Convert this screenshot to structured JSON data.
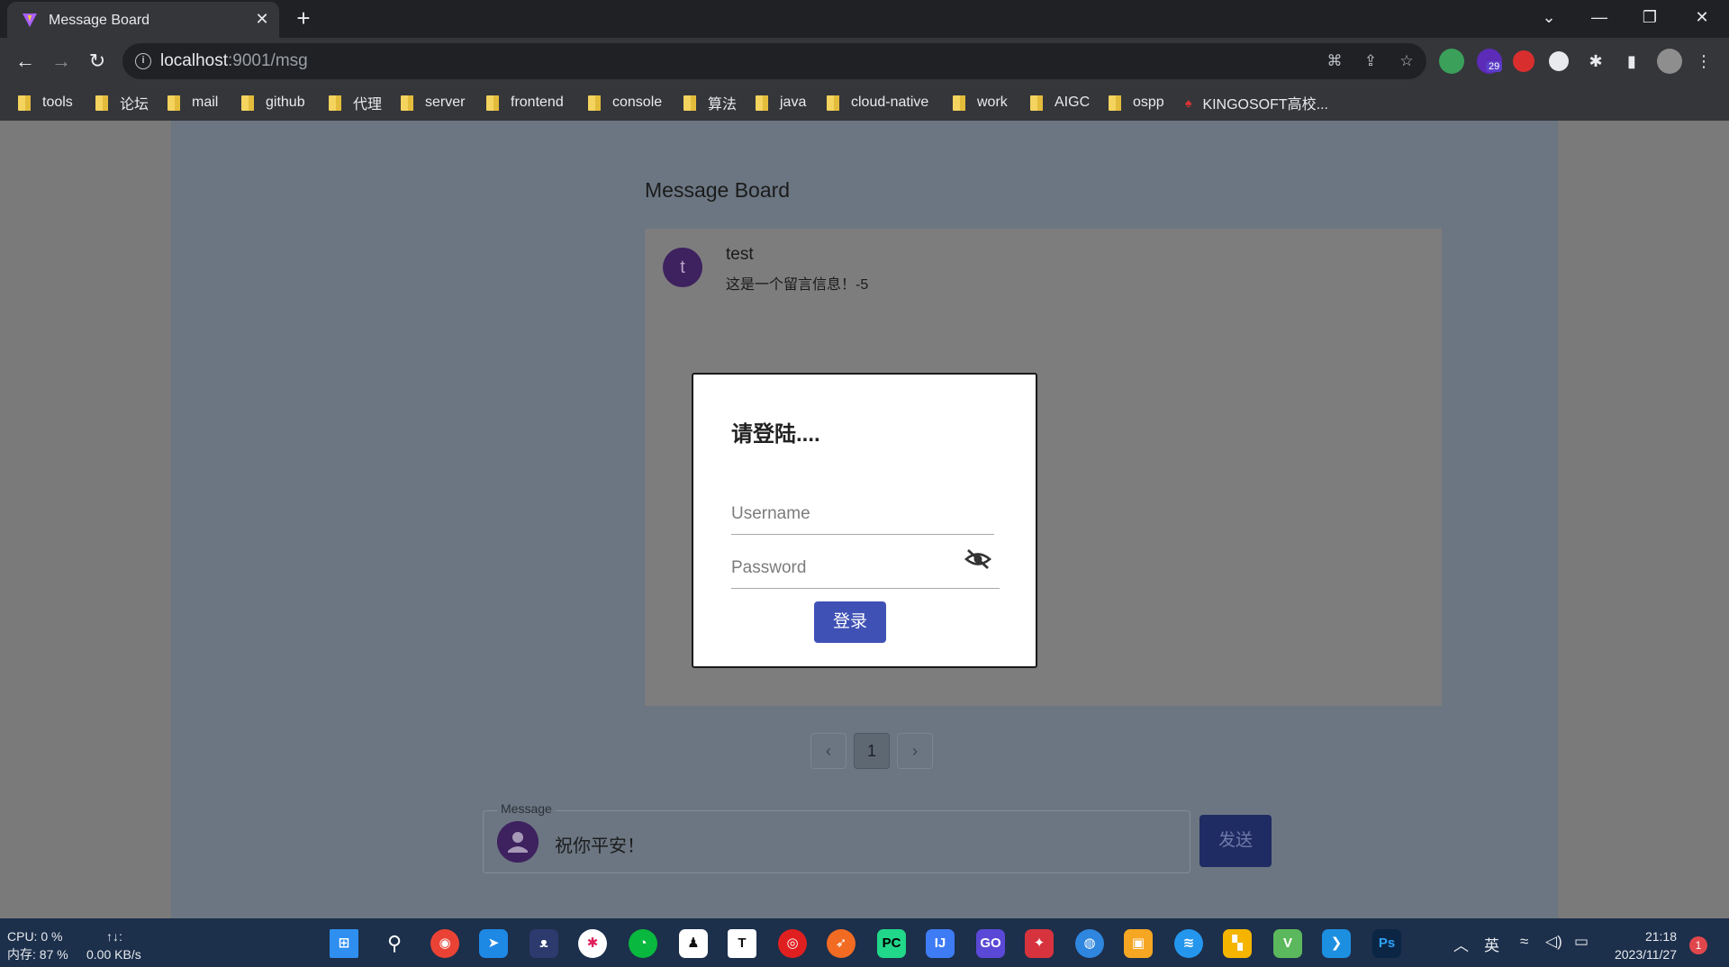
{
  "browser": {
    "tab_title": "Message Board",
    "url_host": "localhost",
    "url_rest": ":9001/msg",
    "extension_badge": "29",
    "bookmarks": [
      "tools",
      "论坛",
      "mail",
      "github",
      "代理",
      "server",
      "frontend",
      "console",
      "算法",
      "java",
      "cloud-native",
      "work",
      "AIGC",
      "ospp",
      "KINGOSOFT高校..."
    ]
  },
  "page": {
    "title": "Message Board",
    "messages": [
      {
        "avatar_letter": "t",
        "user": "test",
        "text": "这是一个留言信息！-5"
      }
    ],
    "pagination": {
      "prev": "‹",
      "current": "1",
      "next": "›"
    },
    "composer": {
      "legend": "Message",
      "value": "祝你平安！",
      "send_label": "发送"
    }
  },
  "login_dialog": {
    "title": "请登陆....",
    "username_label": "Username",
    "password_label": "Password",
    "submit_label": "登录"
  },
  "taskbar": {
    "cpu": "CPU: 0 %",
    "memory": "内存: 87 %",
    "net_label": "↑↓:",
    "net_speed": "0.00 KB/s",
    "ime": "英",
    "time": "21:18",
    "date": "2023/11/27",
    "notification_count": "1"
  },
  "colors": {
    "accent": "#3f51b5",
    "avatar": "#3e215f",
    "tab_bg": "#35363a",
    "taskbar": "#1c2f4b"
  }
}
